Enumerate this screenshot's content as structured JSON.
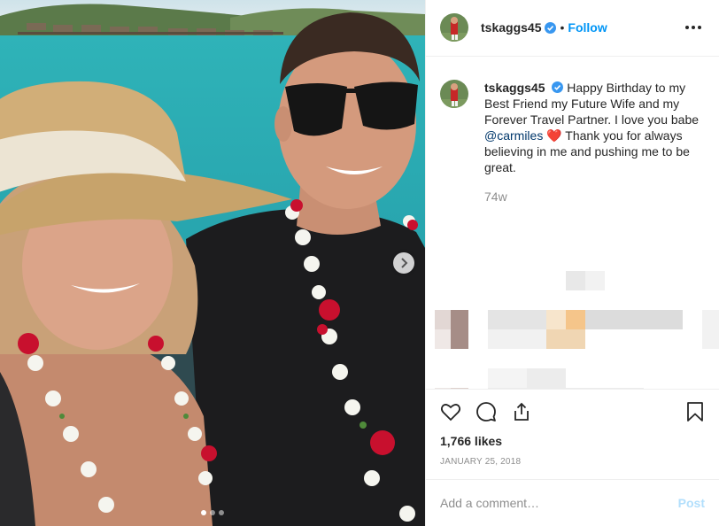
{
  "post": {
    "username": "tskaggs45",
    "verified": true,
    "follow_label": "Follow",
    "separator": "•",
    "more_icon": "more-options-icon",
    "caption": {
      "text_before": "Happy Birthday to my Best Friend my Future Wife and my Forever Travel Partner. I love you babe ",
      "mention": "@carmiles",
      "emoji": "❤️",
      "text_after": " Thank you for always believing in me and pushing me to be great."
    },
    "time_ago": "74w",
    "likes": "1,766 likes",
    "date": "JANUARY 25, 2018",
    "carousel": {
      "slides": 3,
      "active": 1
    }
  },
  "actions": {
    "like_icon": "heart-icon",
    "comment_icon": "comment-icon",
    "share_icon": "share-icon",
    "save_icon": "bookmark-icon"
  },
  "comment_form": {
    "placeholder": "Add a comment…",
    "post_label": "Post"
  },
  "colors": {
    "accent": "#0095f6",
    "verified": "#3897f0",
    "muted": "#8e8e8e"
  }
}
